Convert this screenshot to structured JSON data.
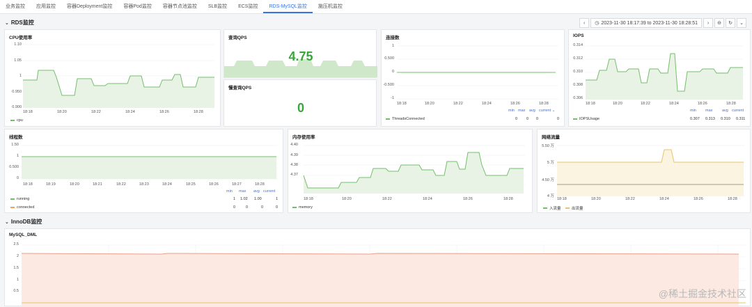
{
  "tabs": [
    "业务监控",
    "应用监控",
    "容器Deployment监控",
    "容器Pod监控",
    "容器节点池监控",
    "SLB监控",
    "ECS监控",
    "RDS-MySQL监控",
    "施压机监控"
  ],
  "active_tab": 7,
  "rows": {
    "rds": "RDS监控",
    "innodb": "InnoDB监控"
  },
  "time_range": "2023-11-30 18:17:39 to 2023-11-30 18:28:51",
  "panels": {
    "cpu": {
      "title": "CPU使用率",
      "y_ticks": [
        "1.10",
        "1.05",
        "1",
        "0.950",
        "0.900"
      ],
      "x_ticks": [
        "18:18",
        "18:20",
        "18:22",
        "18:24",
        "18:26",
        "18:28"
      ],
      "legend": "cpu"
    },
    "qps": {
      "title": "查询QPS",
      "value": "4.75"
    },
    "slowqps": {
      "title": "慢查询QPS",
      "value": "0"
    },
    "conn": {
      "title": "连接数",
      "y_ticks": [
        "1",
        "0.500",
        "0",
        "-0.500",
        "-1"
      ],
      "x_ticks": [
        "18:18",
        "18:20",
        "18:22",
        "18:24",
        "18:26",
        "18:28"
      ],
      "stat_heads": [
        "min",
        "max",
        "avg",
        "current"
      ],
      "legend": "ThreadsConnected",
      "stats": [
        "0",
        "0",
        "0",
        "0"
      ]
    },
    "iops": {
      "title": "IOPS",
      "y_ticks": [
        "0.314",
        "0.312",
        "0.310",
        "0.308",
        "0.306"
      ],
      "x_ticks": [
        "18:18",
        "18:20",
        "18:22",
        "18:24",
        "18:26",
        "18:28"
      ],
      "stat_heads": [
        "min",
        "max",
        "avg",
        "current"
      ],
      "legend": "IOPSUsage",
      "stats": [
        "0.307",
        "0.313",
        "0.310",
        "0.311"
      ]
    },
    "threads": {
      "title": "线程数",
      "y_ticks": [
        "1.50",
        "1",
        "0.500",
        "0"
      ],
      "x_ticks": [
        "18:18",
        "18:19",
        "18:20",
        "18:21",
        "18:22",
        "18:23",
        "18:24",
        "18:25",
        "18:26",
        "18:27",
        "18:28"
      ],
      "stat_heads": [
        "min",
        "max",
        "avg",
        "current"
      ],
      "legends": [
        {
          "name": "running",
          "stats": [
            "1",
            "1.02",
            "1.00",
            "1"
          ]
        },
        {
          "name": "connected",
          "stats": [
            "0",
            "0",
            "0",
            "0"
          ]
        }
      ]
    },
    "mem": {
      "title": "内存使用率",
      "y_ticks": [
        "4.40",
        "4.39",
        "4.38",
        "4.37"
      ],
      "x_ticks": [
        "18:18",
        "18:20",
        "18:22",
        "18:24",
        "18:26",
        "18:28"
      ],
      "legend": "memory"
    },
    "net": {
      "title": "网络流量",
      "y_ticks": [
        "5.50 万",
        "5 万",
        "4.50 万",
        "4 万"
      ],
      "x_ticks": [
        "18:18",
        "18:20",
        "18:22",
        "18:24",
        "18:26",
        "18:28"
      ],
      "legends": [
        "入流量",
        "出流量"
      ]
    },
    "dml": {
      "title": "MySQL_DML",
      "y_ticks": [
        "2.5",
        "2",
        "1.5",
        "1",
        "0.5"
      ]
    }
  },
  "colors": {
    "green": "#73bf69",
    "green_fill": "#e8f3e6",
    "yellow": "#e9c46a",
    "orange": "#f2a057",
    "red_line": "#e8a08a",
    "blue": "#3873e0"
  },
  "watermark": "@稀土掘金技术社区"
}
